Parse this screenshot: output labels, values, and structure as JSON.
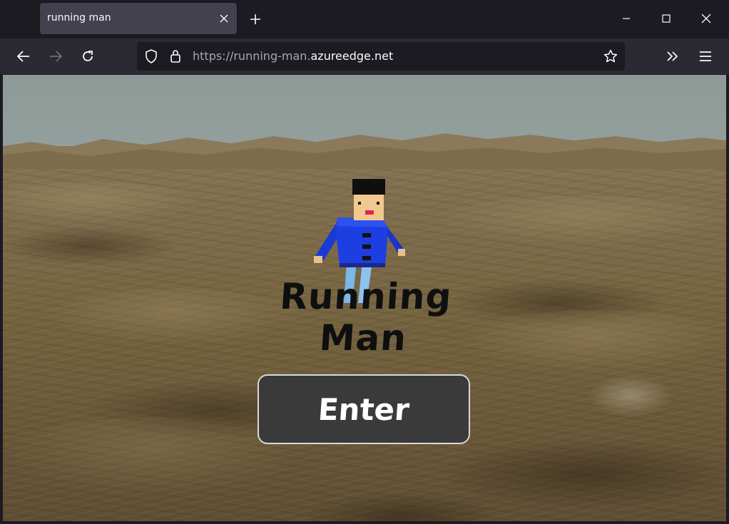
{
  "browser": {
    "tab": {
      "title": "running man"
    },
    "url": {
      "prefix": "https://running-man.",
      "domain": "azureedge.net"
    }
  },
  "page": {
    "title": "Running Man",
    "enter_button": "Enter"
  },
  "icons": {
    "tab_close": "close-icon",
    "new_tab": "plus-icon",
    "minimize": "minimize-icon",
    "maximize": "maximize-icon",
    "close_window": "close-icon",
    "back": "arrow-left-icon",
    "forward": "arrow-right-icon",
    "reload": "reload-icon",
    "shield": "shield-icon",
    "lock": "lock-icon",
    "bookmark": "star-icon",
    "overflow": "chevron-double-right-icon",
    "menu": "hamburger-icon"
  },
  "colors": {
    "chrome_dark": "#1c1b22",
    "toolbar": "#2b2a33",
    "tab_active": "#42414d",
    "sky": "#8e9a97",
    "terrain": "#7f6d4d",
    "button_bg": "#3a3a3a",
    "character_shirt": "#1d3ee0",
    "character_pants": "#7db6e8"
  }
}
